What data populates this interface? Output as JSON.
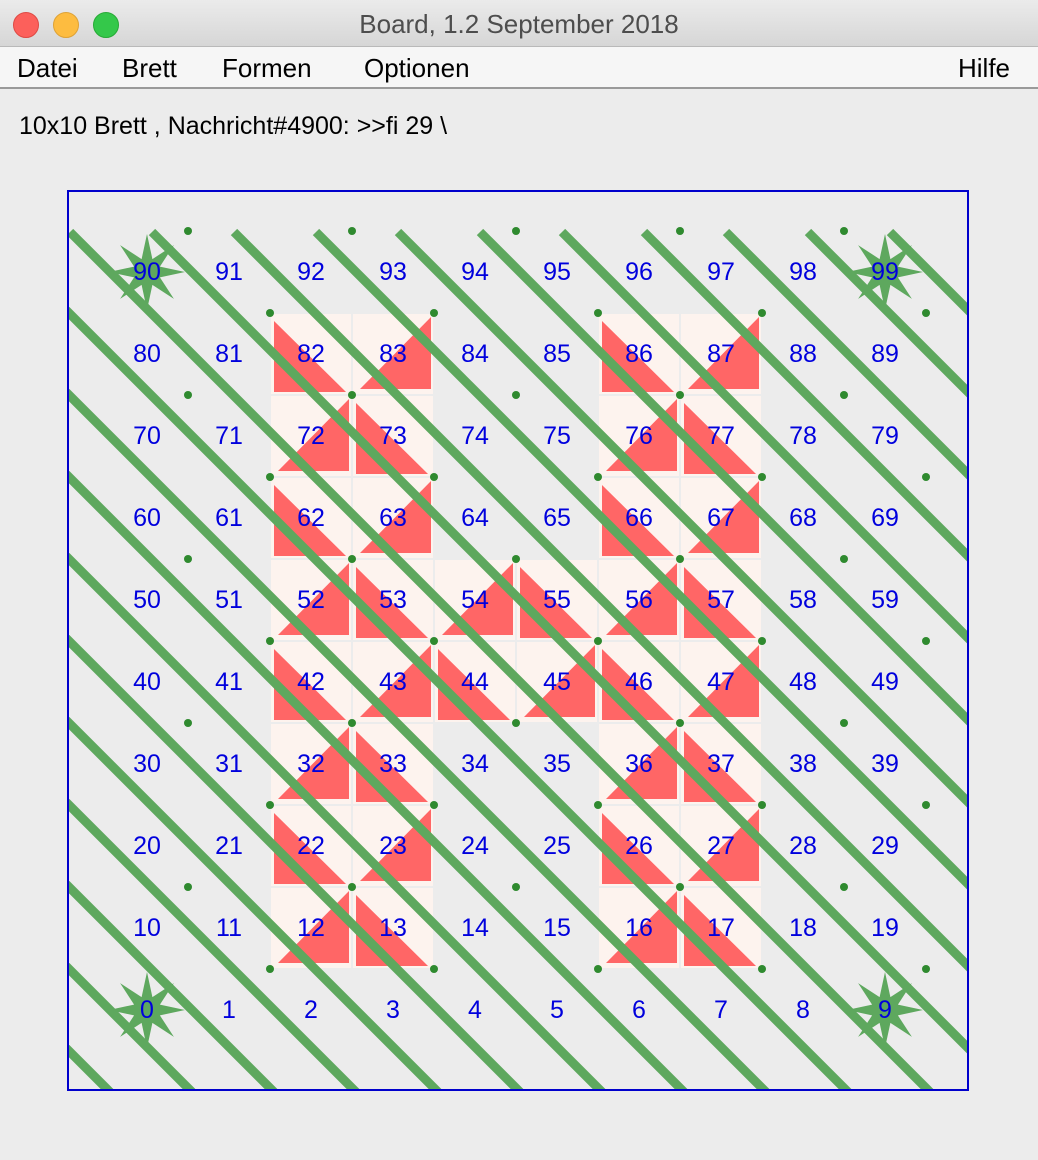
{
  "window": {
    "title": "Board, 1.2 September 2018"
  },
  "menu": {
    "file": "Datei",
    "board": "Brett",
    "shapes": "Formen",
    "options": "Optionen",
    "help": "Hilfe"
  },
  "status_line": "10x10 Brett , Nachricht#4900: >>fi 29 \\",
  "board": {
    "rows": 10,
    "cols": 10,
    "numbers": [
      "0",
      "1",
      "2",
      "3",
      "4",
      "5",
      "6",
      "7",
      "8",
      "9",
      "10",
      "11",
      "12",
      "13",
      "14",
      "15",
      "16",
      "17",
      "18",
      "19",
      "20",
      "21",
      "22",
      "23",
      "24",
      "25",
      "26",
      "27",
      "28",
      "29",
      "30",
      "31",
      "32",
      "33",
      "34",
      "35",
      "36",
      "37",
      "38",
      "39",
      "40",
      "41",
      "42",
      "43",
      "44",
      "45",
      "46",
      "47",
      "48",
      "49",
      "50",
      "51",
      "52",
      "53",
      "54",
      "55",
      "56",
      "57",
      "58",
      "59",
      "60",
      "61",
      "62",
      "63",
      "64",
      "65",
      "66",
      "67",
      "68",
      "69",
      "70",
      "71",
      "72",
      "73",
      "74",
      "75",
      "76",
      "77",
      "78",
      "79",
      "80",
      "81",
      "82",
      "83",
      "84",
      "85",
      "86",
      "87",
      "88",
      "89",
      "90",
      "91",
      "92",
      "93",
      "94",
      "95",
      "96",
      "97",
      "98",
      "99"
    ],
    "star_cells": [
      0,
      9,
      90,
      99
    ],
    "shaded_cells": [
      12,
      13,
      16,
      17,
      22,
      23,
      26,
      27,
      32,
      33,
      36,
      37,
      42,
      43,
      44,
      45,
      46,
      47,
      52,
      53,
      54,
      55,
      56,
      57,
      62,
      63,
      66,
      67,
      72,
      73,
      76,
      77,
      82,
      83,
      86,
      87
    ],
    "colors": {
      "frame": "#0000cc",
      "number": "#0000dd",
      "stripe": "#5ea85e",
      "stripe_dot": "#2f8a2f",
      "star": "#5ea85e",
      "cell_light": "#fdf3ee",
      "cell_red": "#ff6666"
    }
  }
}
